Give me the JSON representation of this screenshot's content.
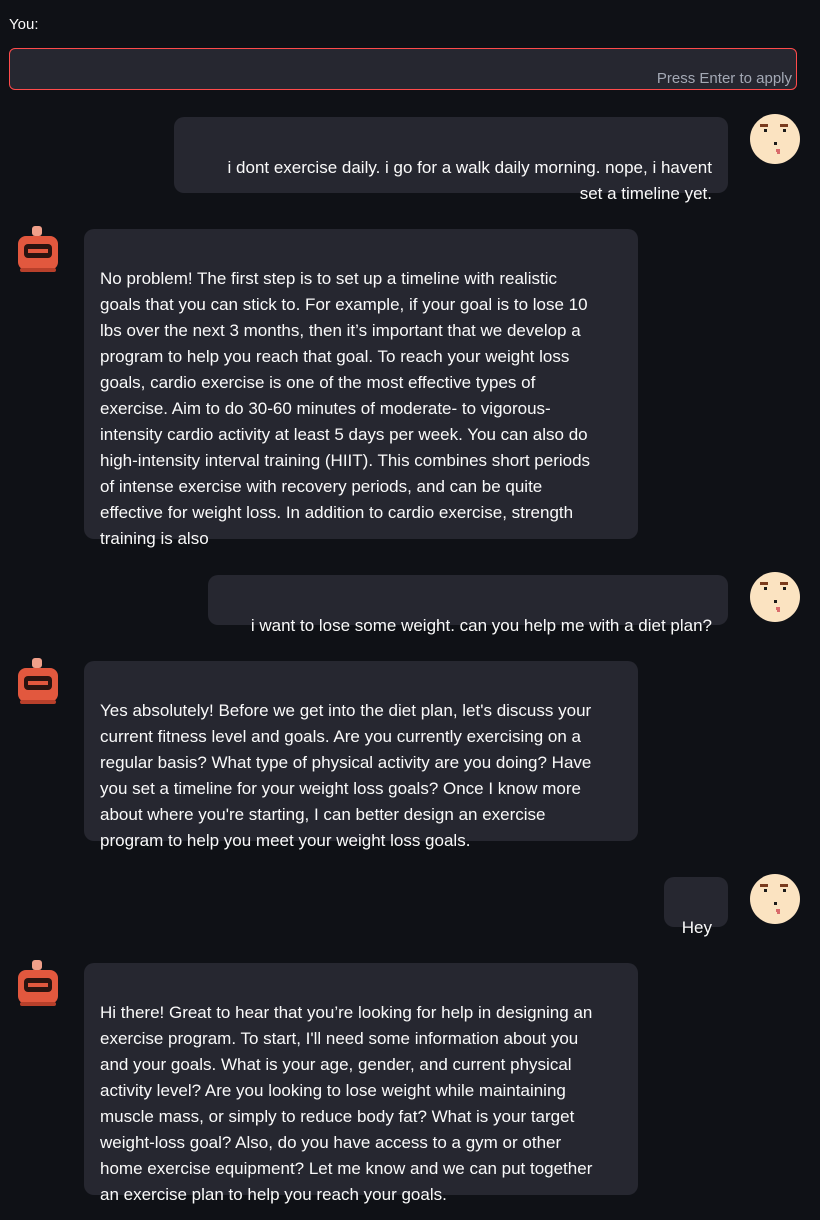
{
  "input": {
    "label": "You:",
    "value": "",
    "hint": "Press Enter to apply"
  },
  "messages": [
    {
      "role": "user",
      "text": "i dont exercise daily. i go for a walk daily morning. nope, i havent\nset a timeline yet."
    },
    {
      "role": "bot",
      "text": "No problem! The first step is to set up a timeline with realistic\ngoals that you can stick to. For example, if your goal is to lose 10\nlbs over the next 3 months, then it’s important that we develop a\nprogram to help you reach that goal. To reach your weight loss\ngoals, cardio exercise is one of the most effective types of\nexercise. Aim to do 30-60 minutes of moderate- to vigorous-\nintensity cardio activity at least 5 days per week. You can also do\nhigh-intensity interval training (HIIT). This combines short periods\nof intense exercise with recovery periods, and can be quite\neffective for weight loss. In addition to cardio exercise, strength\ntraining is also"
    },
    {
      "role": "user",
      "text": "i want to lose some weight. can you help me with a diet plan?"
    },
    {
      "role": "bot",
      "text": "Yes absolutely! Before we get into the diet plan, let's discuss your\ncurrent fitness level and goals. Are you currently exercising on a\nregular basis? What type of physical activity are you doing? Have\nyou set a timeline for your weight loss goals? Once I know more\nabout where you're starting, I can better design an exercise\nprogram to help you meet your weight loss goals."
    },
    {
      "role": "user",
      "text": "Hey"
    },
    {
      "role": "bot",
      "text": "Hi there! Great to hear that you’re looking for help in designing an\nexercise program. To start, I'll need some information about you\nand your goals. What is your age, gender, and current physical\nactivity level? Are you looking to lose weight while maintaining\nmuscle mass, or simply to reduce body fat? What is your target\nweight-loss goal? Also, do you have access to a gym or other\nhome exercise equipment? Let me know and we can put together\nan exercise plan to help you reach your goals."
    }
  ],
  "avatars": {
    "user": "user-avatar-icon",
    "bot": "bot-avatar-icon"
  },
  "colors": {
    "background": "#0f1116",
    "bubble": "#262730",
    "text": "#fafafa",
    "input_border": "#ff4b4b",
    "hint": "#a3a8b4"
  }
}
